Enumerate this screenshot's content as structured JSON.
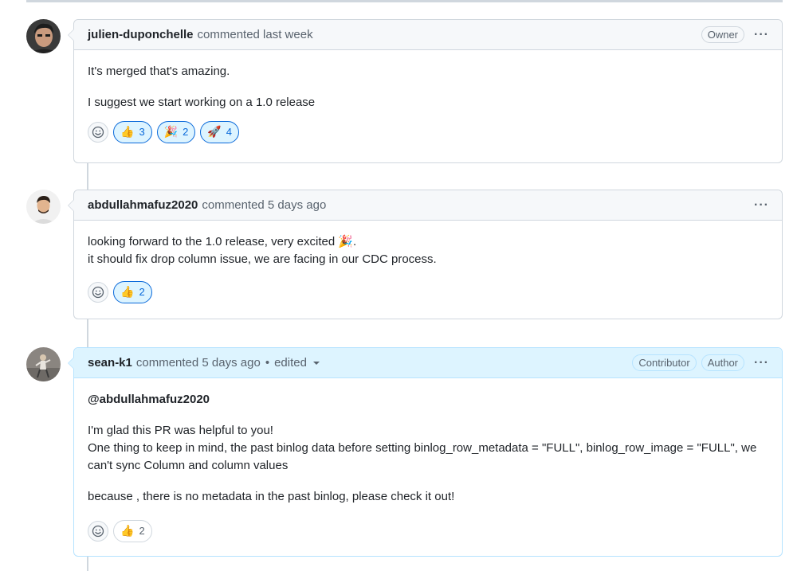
{
  "comments": [
    {
      "user": "julien-duponchelle",
      "meta": "commented last week",
      "badges": [
        "Owner"
      ],
      "paragraphs": [
        "It's merged that's amazing.",
        "I suggest we start working on a 1.0 release"
      ],
      "reactions": [
        {
          "emoji": "👍",
          "icon": "thumbs-up-icon",
          "count": "3"
        },
        {
          "emoji": "🎉",
          "icon": "tada-icon",
          "count": "2"
        },
        {
          "emoji": "🚀",
          "icon": "rocket-icon",
          "count": "4"
        }
      ]
    },
    {
      "user": "abdullahmafuz2020",
      "meta": "commented 5 days ago",
      "lines": [
        "looking forward to the 1.0 release, very excited 🎉.",
        "it should fix drop column issue, we are facing in our CDC process."
      ],
      "reactions": [
        {
          "emoji": "👍",
          "icon": "thumbs-up-icon",
          "count": "2"
        }
      ]
    },
    {
      "user": "sean-k1",
      "meta": "commented 5 days ago",
      "edited": "edited",
      "separator": "•",
      "badges": [
        "Contributor",
        "Author"
      ],
      "mention": "@abdullahmafuz2020",
      "para2_line1": "I'm glad this PR was helpful to you!",
      "para2_line2": "One thing to keep in mind, the past binlog data before setting binlog_row_metadata = \"FULL\", binlog_row_image = \"FULL\", we can't sync Column and column values",
      "para3": "because , there is no metadata in the past binlog, please check it out!",
      "reactions": [
        {
          "emoji": "👍",
          "icon": "thumbs-up-icon",
          "count": "2"
        }
      ]
    }
  ],
  "kebab": "···",
  "colors": {
    "accent": "#0969da",
    "author_header": "#ddf4ff",
    "border": "#d0d7de"
  }
}
